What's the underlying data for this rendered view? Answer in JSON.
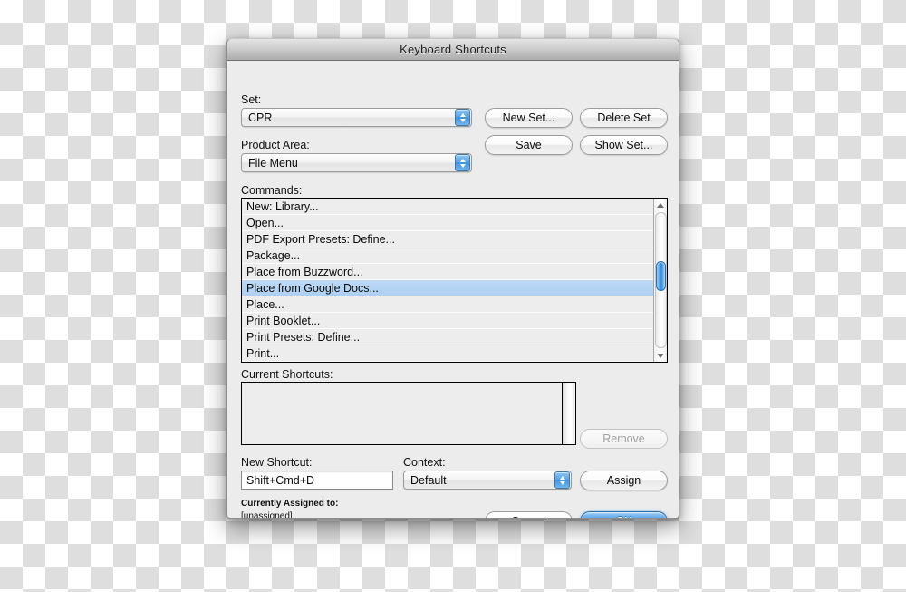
{
  "window": {
    "title": "Keyboard Shortcuts"
  },
  "set_section": {
    "label": "Set:",
    "value": "CPR",
    "new_set_button": "New Set...",
    "delete_set_button": "Delete Set"
  },
  "product_area_section": {
    "label": "Product Area:",
    "value": "File Menu",
    "save_button": "Save",
    "show_set_button": "Show Set..."
  },
  "commands": {
    "label": "Commands:",
    "selected_index": 5,
    "items": [
      "New: Library...",
      "Open...",
      "PDF Export Presets: Define...",
      "Package...",
      "Place from Buzzword...",
      "Place from Google Docs...",
      "Place...",
      "Print Booklet...",
      "Print Presets: Define...",
      "Print..."
    ]
  },
  "current_shortcuts": {
    "label": "Current Shortcuts:",
    "items": [],
    "remove_button": "Remove",
    "remove_enabled": false
  },
  "new_shortcut": {
    "label": "New Shortcut:",
    "value": "Shift+Cmd+D"
  },
  "context": {
    "label": "Context:",
    "value": "Default"
  },
  "assign_button": "Assign",
  "assigned_to": {
    "label": "Currently Assigned to:",
    "value": "[unassigned]"
  },
  "footer": {
    "cancel_button": "Cancel",
    "ok_button": "OK"
  },
  "colors": {
    "selection_blue": "#b3d4f2",
    "default_button_blue": "#3f92e4",
    "window_bg": "#ececec",
    "list_bg": "#ededed"
  }
}
